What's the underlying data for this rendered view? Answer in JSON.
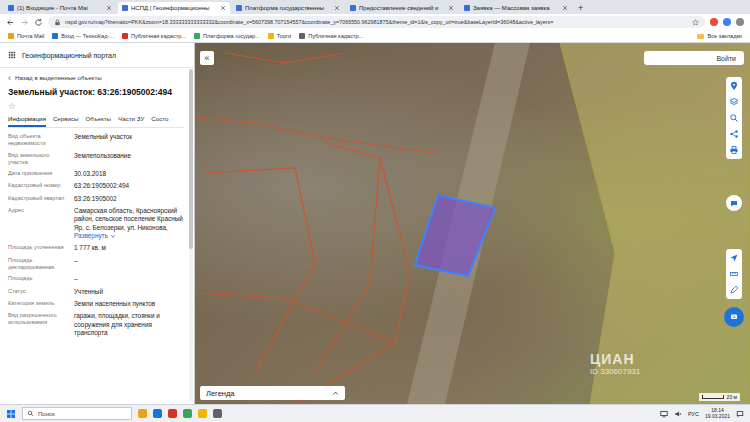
{
  "browser": {
    "tabs": [
      {
        "label": "(1) Входящие - Почта Mai",
        "selected": false
      },
      {
        "label": "НСПД | Геоинформационны",
        "selected": true
      },
      {
        "label": "Платформа государственны",
        "selected": false
      },
      {
        "label": "Предоставление сведений и",
        "selected": false
      },
      {
        "label": "Заявка — Массовая заявка",
        "selected": false
      }
    ],
    "new_tab": "+",
    "url": "nspd.gov.ru/map?thematic=PKK&zoom=18.333333333333332&coordinate_x=5607398.707154557&coordinate_y=7065550.962981875&theme_id=1&is_copy_url=true&baseLayerId=36048&active_layers=",
    "bookmarks": [
      "Почта Mail",
      "Вход — ТехноКад-...",
      "Публичная кадастр...",
      "Платформа государ...",
      "Торги",
      "Публичная кадастр..."
    ],
    "all_bookmarks": "Все закладки"
  },
  "panel": {
    "portal_title": "Геоинформационный портал",
    "back_arrow": "‹",
    "back": "Назад в выделенные объекты",
    "title": "Земельный участок: 63:26:1905002:494",
    "star": "☆",
    "tabs": [
      {
        "label": "Информация",
        "selected": true
      },
      {
        "label": "Сервисы",
        "selected": false
      },
      {
        "label": "Объекты",
        "selected": false
      },
      {
        "label": "Части ЗУ",
        "selected": false
      },
      {
        "label": "Состо",
        "selected": false
      }
    ],
    "fields": [
      {
        "label": "Вид объекта недвижимости",
        "value": "Земельный участок"
      },
      {
        "label": "Вид земельного участка",
        "value": "Землепользование"
      },
      {
        "label": "Дата присвоения",
        "value": "30.03.2018"
      },
      {
        "label": "Кадастровый номер",
        "value": "63:26:1905002:494"
      },
      {
        "label": "Кадастровый квартал",
        "value": "63:26:1905002"
      },
      {
        "label": "Адрес",
        "value": "Самарская область, Красноярский район, сельское поселение Красный Яр, с. Белозерки, ул. Никонова,",
        "link": "Развернуть"
      },
      {
        "label": "Площадь уточненная",
        "value": "1 777 кв. м"
      },
      {
        "label": "Площадь декларированная",
        "value": "–"
      },
      {
        "label": "Площадь",
        "value": "–"
      },
      {
        "label": "Статус",
        "value": "Учтенный"
      },
      {
        "label": "Категория земель",
        "value": "Земли населенных пунктов"
      },
      {
        "label": "Вид разрешенного использования",
        "value": "гаражи, площадки, стоянки и сооружения для хранения транспорта"
      }
    ]
  },
  "map": {
    "collapse": "«",
    "login": "Войти",
    "legend": "Легенда",
    "watermark_brand": "ЦИАН",
    "watermark_id": "ID 330607931",
    "scale": "20 м"
  },
  "taskbar": {
    "search": "Поиск",
    "language": "РУС",
    "time": "18:14",
    "date": "19.03.2021"
  }
}
